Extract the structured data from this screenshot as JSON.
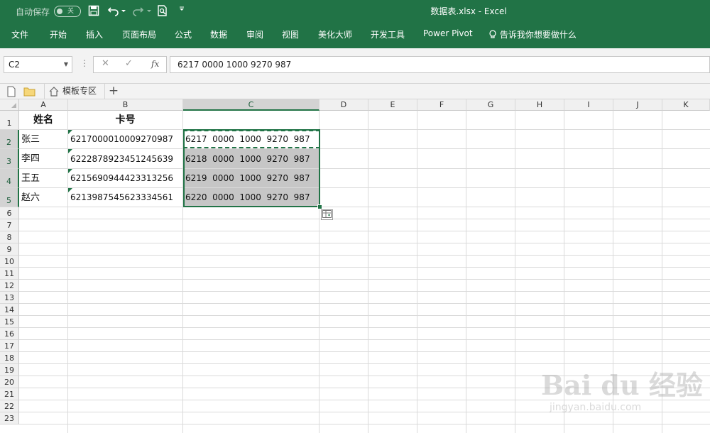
{
  "titlebar": {
    "autosave_label": "自动保存",
    "autosave_state": "关",
    "window_title": "数据表.xlsx  -  Excel",
    "bg_color": "#217346"
  },
  "ribbon_tabs": [
    "文件",
    "开始",
    "插入",
    "页面布局",
    "公式",
    "数据",
    "审阅",
    "视图",
    "美化大师",
    "开发工具",
    "Power Pivot"
  ],
  "tell_me": "告诉我你想要做什么",
  "formula_bar": {
    "name_box": "C2",
    "fx_label": "fx",
    "content": "6217 0000 1000 9270 987"
  },
  "doc_tabs": {
    "template_tab": "模板专区",
    "add_label": "+"
  },
  "columns": [
    "A",
    "B",
    "C",
    "D",
    "E",
    "F",
    "G",
    "H",
    "I",
    "J",
    "K"
  ],
  "rows": [
    "1",
    "2",
    "3",
    "4",
    "5",
    "6",
    "7",
    "8",
    "9",
    "10",
    "11",
    "12",
    "13",
    "14",
    "15",
    "16",
    "17",
    "18",
    "19",
    "20",
    "21",
    "22",
    "23"
  ],
  "sheet": {
    "header": [
      "姓名",
      "卡号"
    ],
    "data": [
      {
        "name": "张三",
        "card": "6217000010009270987",
        "formatted": "6217  0000  1000  9270  987"
      },
      {
        "name": "李四",
        "card": "6222878923451245639",
        "formatted": "6218  0000  1000  9270  987"
      },
      {
        "name": "王五",
        "card": "6215690944423313256",
        "formatted": "6219  0000  1000  9270  987"
      },
      {
        "name": "赵六",
        "card": "6213987545623334561",
        "formatted": "6220  0000  1000  9270  987"
      }
    ]
  },
  "selection": {
    "active_cell": "C2",
    "range": "C2:C5"
  },
  "watermark": {
    "main": "Bai du 经验",
    "sub": "jingyan.baidu.com"
  }
}
